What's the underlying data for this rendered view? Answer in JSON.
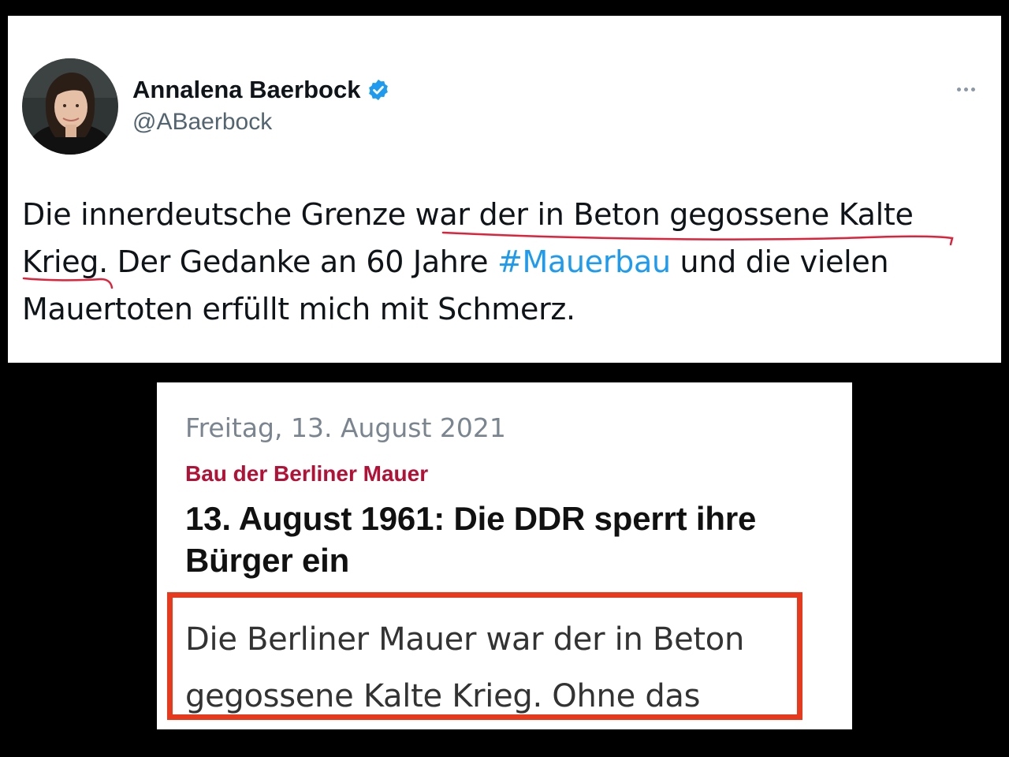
{
  "tweet": {
    "display_name": "Annalena Baerbock",
    "handle": "@ABaerbock",
    "verified": true,
    "verified_icon": "verified-badge-icon",
    "more_icon": "more-options-icon",
    "text_line1_pre": "Die innerdeutsche Grenze ",
    "text_underlined_1": "war der in Beton gegossene Kalte",
    "text_underlined_2": "Krieg",
    "text_after_underline": ". Der Gedanke an 60 Jahre ",
    "hashtag": "#Mauerbau",
    "text_after_hashtag": " und die vielen Mauertoten erfüllt mich mit Schmerz.",
    "hashtag_color": "#1d9bf0",
    "underline_color": "#e0213a"
  },
  "article": {
    "date": "Freitag, 13. August 2021",
    "kicker": "Bau der Berliner Mauer",
    "headline": "13. August 1961: Die DDR sperrt ihre Bürger ein",
    "excerpt": "Die Berliner Mauer war der in Beton gegossene Kalte Krieg. Ohne das",
    "kicker_color": "#b40f35",
    "highlight_color": "#e8391d"
  }
}
